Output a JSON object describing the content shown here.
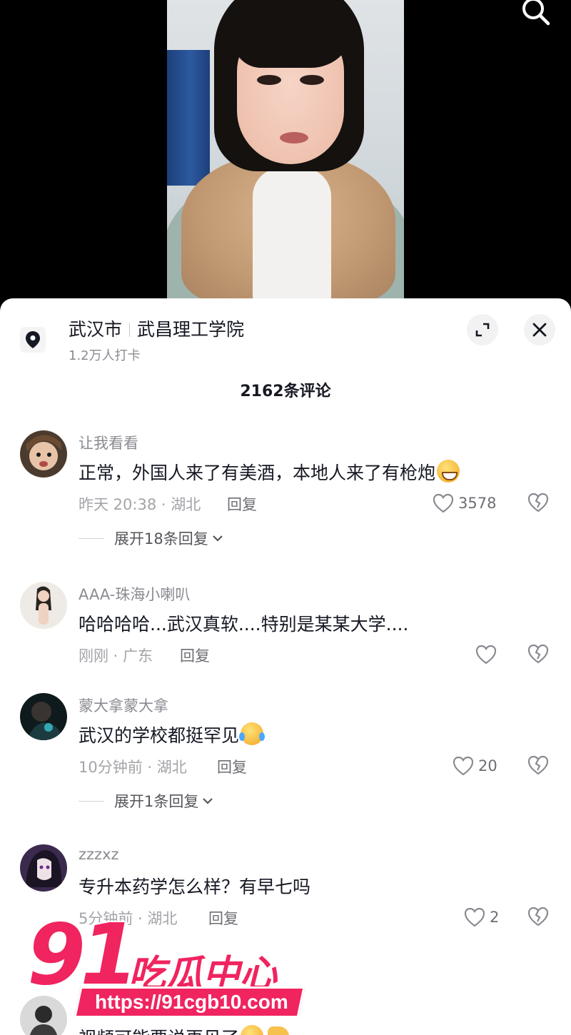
{
  "location": {
    "city": "武汉市",
    "place": "武昌理工学院",
    "checkins": "1.2万人打卡"
  },
  "comment_count_label": "2162条评论",
  "comments": [
    {
      "user": "让我看看",
      "text": "正常，外国人来了有美酒，本地人来了有枪炮",
      "emoji": "grinning-sweat-emoji",
      "meta": "昨天 20:38 · 湖北",
      "reply_label": "回复",
      "likes": "3578",
      "expand_label": "展开18条回复"
    },
    {
      "user": "AAA-珠海小喇叭",
      "text": "哈哈哈哈...武汉真软....特别是某某大学....",
      "meta": "刚刚 · 广东",
      "reply_label": "回复",
      "likes": ""
    },
    {
      "user": "蒙大拿蒙大拿",
      "text": "武汉的学校都挺罕见",
      "emoji": "tears-of-joy-emoji",
      "meta": "10分钟前 · 湖北",
      "reply_label": "回复",
      "likes": "20",
      "expand_label": "展开1条回复"
    },
    {
      "user": "zzzxz",
      "text": "专升本药学怎么样？有早七吗",
      "meta": "5分钟前 · 湖北",
      "reply_label": "回复",
      "likes": "2"
    },
    {
      "user": "",
      "text": "视频可能要说再见了",
      "emoji": "tears-of-joy-emoji"
    }
  ],
  "watermark": {
    "number": "91",
    "brand": "吃瓜中心",
    "url": "https://91cgb10.com"
  },
  "colors": {
    "accent": "#f0245f",
    "text_primary": "#161823",
    "text_secondary": "#8a8b91"
  }
}
